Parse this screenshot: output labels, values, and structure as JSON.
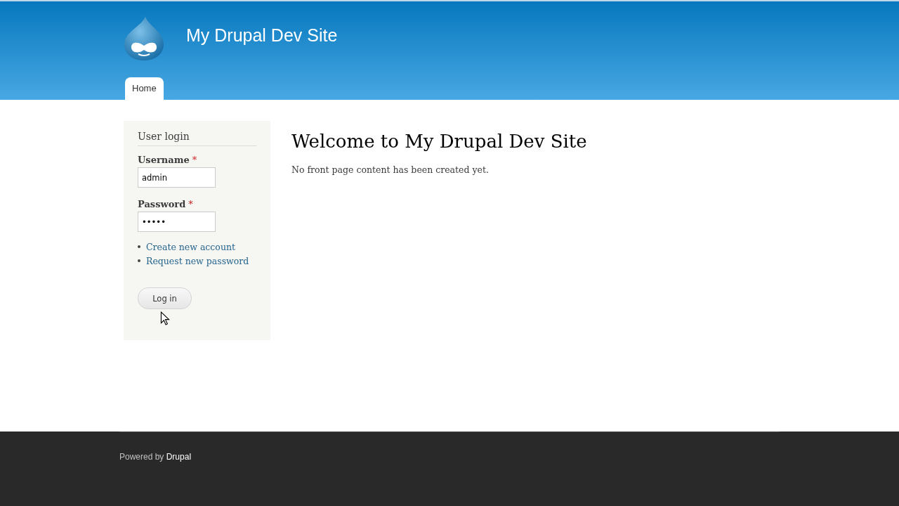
{
  "site": {
    "name": "My Drupal Dev Site"
  },
  "tabs": [
    {
      "label": "Home",
      "selected": true
    }
  ],
  "login_block": {
    "title": "User login",
    "fields": [
      {
        "label": "Username",
        "required_mark": "*",
        "value": "admin"
      },
      {
        "label": "Password",
        "required_mark": "*",
        "value": "•••••"
      }
    ],
    "links": [
      "Create new account",
      "Request new password"
    ],
    "button": "Log in"
  },
  "content": {
    "title": "Welcome to My Drupal Dev Site",
    "message": "No front page content has been created yet."
  },
  "footer": {
    "text": "Powered by",
    "link": "Drupal"
  }
}
